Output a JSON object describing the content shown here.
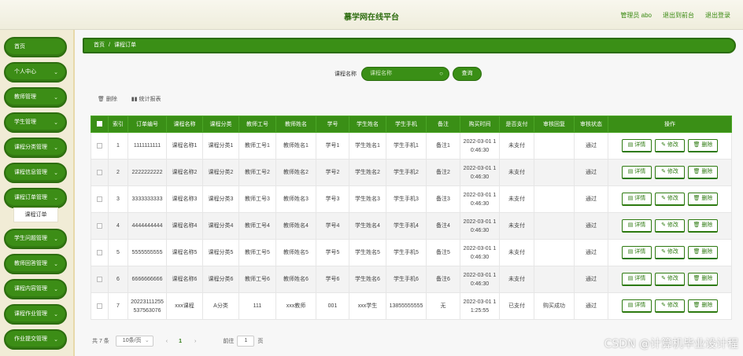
{
  "header": {
    "title": "慕学网在线平台",
    "user": "管理员 abo",
    "back_to_front": "退出到前台",
    "logout": "退出登录"
  },
  "sidebar": {
    "items": [
      {
        "label": "首页",
        "chevron": false
      },
      {
        "label": "个人中心",
        "chevron": true
      },
      {
        "label": "教师管理",
        "chevron": true
      },
      {
        "label": "学生管理",
        "chevron": true
      },
      {
        "label": "课程分类管理",
        "chevron": true
      },
      {
        "label": "课程信息管理",
        "chevron": true
      },
      {
        "label": "课程订单管理",
        "chevron": true
      },
      {
        "label": "学生问题管理",
        "chevron": true
      },
      {
        "label": "教师回答管理",
        "chevron": true
      },
      {
        "label": "课程内容管理",
        "chevron": true
      },
      {
        "label": "课程作业管理",
        "chevron": true
      },
      {
        "label": "作业提交管理",
        "chevron": true
      }
    ],
    "active_sub": "课程订单"
  },
  "breadcrumb": {
    "home": "首页",
    "separator": "/",
    "current": "课程订单"
  },
  "search": {
    "label": "课程名称",
    "placeholder": "课程名称",
    "button": "查询"
  },
  "toolbar": {
    "delete": "删除",
    "report": "统计报表"
  },
  "table": {
    "headers": [
      "",
      "索引",
      "订单编号",
      "课程名称",
      "课程分类",
      "教师工号",
      "教师姓名",
      "学号",
      "学生姓名",
      "学生手机",
      "备注",
      "购买时间",
      "是否支付",
      "审核回复",
      "审核状态",
      "操作"
    ],
    "rows": [
      {
        "idx": "1",
        "order": "1111111111",
        "course": "课程名称1",
        "category": "课程分类1",
        "teacher_no": "教师工号1",
        "teacher": "教师姓名1",
        "student_no": "学号1",
        "student": "学生姓名1",
        "phone": "学生手机1",
        "note": "备注1",
        "time": "2022-03-01 10:46:30",
        "paid": "未支付",
        "reply": "",
        "status": "通过"
      },
      {
        "idx": "2",
        "order": "2222222222",
        "course": "课程名称2",
        "category": "课程分类2",
        "teacher_no": "教师工号2",
        "teacher": "教师姓名2",
        "student_no": "学号2",
        "student": "学生姓名2",
        "phone": "学生手机2",
        "note": "备注2",
        "time": "2022-03-01 10:46:30",
        "paid": "未支付",
        "reply": "",
        "status": "通过"
      },
      {
        "idx": "3",
        "order": "3333333333",
        "course": "课程名称3",
        "category": "课程分类3",
        "teacher_no": "教师工号3",
        "teacher": "教师姓名3",
        "student_no": "学号3",
        "student": "学生姓名3",
        "phone": "学生手机3",
        "note": "备注3",
        "time": "2022-03-01 10:46:30",
        "paid": "未支付",
        "reply": "",
        "status": "通过"
      },
      {
        "idx": "4",
        "order": "4444444444",
        "course": "课程名称4",
        "category": "课程分类4",
        "teacher_no": "教师工号4",
        "teacher": "教师姓名4",
        "student_no": "学号4",
        "student": "学生姓名4",
        "phone": "学生手机4",
        "note": "备注4",
        "time": "2022-03-01 10:46:30",
        "paid": "未支付",
        "reply": "",
        "status": "通过"
      },
      {
        "idx": "5",
        "order": "5555555555",
        "course": "课程名称5",
        "category": "课程分类5",
        "teacher_no": "教师工号5",
        "teacher": "教师姓名5",
        "student_no": "学号5",
        "student": "学生姓名5",
        "phone": "学生手机5",
        "note": "备注5",
        "time": "2022-03-01 10:46:30",
        "paid": "未支付",
        "reply": "",
        "status": "通过"
      },
      {
        "idx": "6",
        "order": "6666666666",
        "course": "课程名称6",
        "category": "课程分类6",
        "teacher_no": "教师工号6",
        "teacher": "教师姓名6",
        "student_no": "学号6",
        "student": "学生姓名6",
        "phone": "学生手机6",
        "note": "备注6",
        "time": "2022-03-01 10:46:30",
        "paid": "未支付",
        "reply": "",
        "status": "通过"
      },
      {
        "idx": "7",
        "order": "20223111255537563076",
        "course": "xxx课程",
        "category": "A分类",
        "teacher_no": "111",
        "teacher": "xxx教师",
        "student_no": "001",
        "student": "xxx学生",
        "phone": "13855555555",
        "note": "无",
        "time": "2022-03-01 11:25:55",
        "paid": "已支付",
        "reply": "购买成功",
        "status": "通过"
      }
    ],
    "actions": {
      "detail": "详情",
      "edit": "修改",
      "delete": "删除"
    }
  },
  "pagination": {
    "total": "共 7 条",
    "page_size": "10条/页",
    "prev": "‹",
    "current": "1",
    "next": "›",
    "goto": "前往",
    "page_input": "1",
    "unit": "页"
  },
  "watermark": "CSDN @计算机毕业设计程",
  "colors": {
    "accent": "#3a8f16",
    "accent_dark": "#2b6c0e",
    "background": "#f3efdf"
  }
}
